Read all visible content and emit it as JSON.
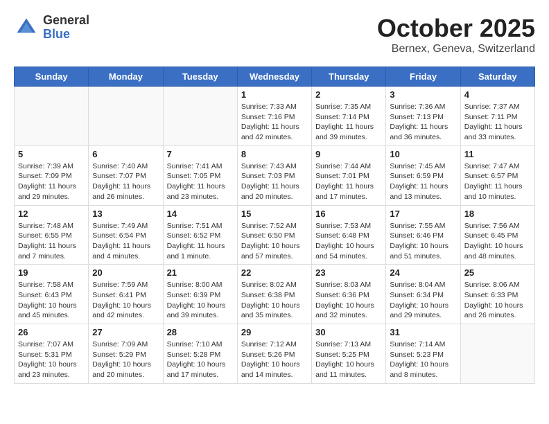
{
  "header": {
    "logo_general": "General",
    "logo_blue": "Blue",
    "month_title": "October 2025",
    "subtitle": "Bernex, Geneva, Switzerland"
  },
  "days_of_week": [
    "Sunday",
    "Monday",
    "Tuesday",
    "Wednesday",
    "Thursday",
    "Friday",
    "Saturday"
  ],
  "weeks": [
    [
      {
        "day": "",
        "info": ""
      },
      {
        "day": "",
        "info": ""
      },
      {
        "day": "",
        "info": ""
      },
      {
        "day": "1",
        "info": "Sunrise: 7:33 AM\nSunset: 7:16 PM\nDaylight: 11 hours and 42 minutes."
      },
      {
        "day": "2",
        "info": "Sunrise: 7:35 AM\nSunset: 7:14 PM\nDaylight: 11 hours and 39 minutes."
      },
      {
        "day": "3",
        "info": "Sunrise: 7:36 AM\nSunset: 7:13 PM\nDaylight: 11 hours and 36 minutes."
      },
      {
        "day": "4",
        "info": "Sunrise: 7:37 AM\nSunset: 7:11 PM\nDaylight: 11 hours and 33 minutes."
      }
    ],
    [
      {
        "day": "5",
        "info": "Sunrise: 7:39 AM\nSunset: 7:09 PM\nDaylight: 11 hours and 29 minutes."
      },
      {
        "day": "6",
        "info": "Sunrise: 7:40 AM\nSunset: 7:07 PM\nDaylight: 11 hours and 26 minutes."
      },
      {
        "day": "7",
        "info": "Sunrise: 7:41 AM\nSunset: 7:05 PM\nDaylight: 11 hours and 23 minutes."
      },
      {
        "day": "8",
        "info": "Sunrise: 7:43 AM\nSunset: 7:03 PM\nDaylight: 11 hours and 20 minutes."
      },
      {
        "day": "9",
        "info": "Sunrise: 7:44 AM\nSunset: 7:01 PM\nDaylight: 11 hours and 17 minutes."
      },
      {
        "day": "10",
        "info": "Sunrise: 7:45 AM\nSunset: 6:59 PM\nDaylight: 11 hours and 13 minutes."
      },
      {
        "day": "11",
        "info": "Sunrise: 7:47 AM\nSunset: 6:57 PM\nDaylight: 11 hours and 10 minutes."
      }
    ],
    [
      {
        "day": "12",
        "info": "Sunrise: 7:48 AM\nSunset: 6:55 PM\nDaylight: 11 hours and 7 minutes."
      },
      {
        "day": "13",
        "info": "Sunrise: 7:49 AM\nSunset: 6:54 PM\nDaylight: 11 hours and 4 minutes."
      },
      {
        "day": "14",
        "info": "Sunrise: 7:51 AM\nSunset: 6:52 PM\nDaylight: 11 hours and 1 minute."
      },
      {
        "day": "15",
        "info": "Sunrise: 7:52 AM\nSunset: 6:50 PM\nDaylight: 10 hours and 57 minutes."
      },
      {
        "day": "16",
        "info": "Sunrise: 7:53 AM\nSunset: 6:48 PM\nDaylight: 10 hours and 54 minutes."
      },
      {
        "day": "17",
        "info": "Sunrise: 7:55 AM\nSunset: 6:46 PM\nDaylight: 10 hours and 51 minutes."
      },
      {
        "day": "18",
        "info": "Sunrise: 7:56 AM\nSunset: 6:45 PM\nDaylight: 10 hours and 48 minutes."
      }
    ],
    [
      {
        "day": "19",
        "info": "Sunrise: 7:58 AM\nSunset: 6:43 PM\nDaylight: 10 hours and 45 minutes."
      },
      {
        "day": "20",
        "info": "Sunrise: 7:59 AM\nSunset: 6:41 PM\nDaylight: 10 hours and 42 minutes."
      },
      {
        "day": "21",
        "info": "Sunrise: 8:00 AM\nSunset: 6:39 PM\nDaylight: 10 hours and 39 minutes."
      },
      {
        "day": "22",
        "info": "Sunrise: 8:02 AM\nSunset: 6:38 PM\nDaylight: 10 hours and 35 minutes."
      },
      {
        "day": "23",
        "info": "Sunrise: 8:03 AM\nSunset: 6:36 PM\nDaylight: 10 hours and 32 minutes."
      },
      {
        "day": "24",
        "info": "Sunrise: 8:04 AM\nSunset: 6:34 PM\nDaylight: 10 hours and 29 minutes."
      },
      {
        "day": "25",
        "info": "Sunrise: 8:06 AM\nSunset: 6:33 PM\nDaylight: 10 hours and 26 minutes."
      }
    ],
    [
      {
        "day": "26",
        "info": "Sunrise: 7:07 AM\nSunset: 5:31 PM\nDaylight: 10 hours and 23 minutes."
      },
      {
        "day": "27",
        "info": "Sunrise: 7:09 AM\nSunset: 5:29 PM\nDaylight: 10 hours and 20 minutes."
      },
      {
        "day": "28",
        "info": "Sunrise: 7:10 AM\nSunset: 5:28 PM\nDaylight: 10 hours and 17 minutes."
      },
      {
        "day": "29",
        "info": "Sunrise: 7:12 AM\nSunset: 5:26 PM\nDaylight: 10 hours and 14 minutes."
      },
      {
        "day": "30",
        "info": "Sunrise: 7:13 AM\nSunset: 5:25 PM\nDaylight: 10 hours and 11 minutes."
      },
      {
        "day": "31",
        "info": "Sunrise: 7:14 AM\nSunset: 5:23 PM\nDaylight: 10 hours and 8 minutes."
      },
      {
        "day": "",
        "info": ""
      }
    ]
  ]
}
